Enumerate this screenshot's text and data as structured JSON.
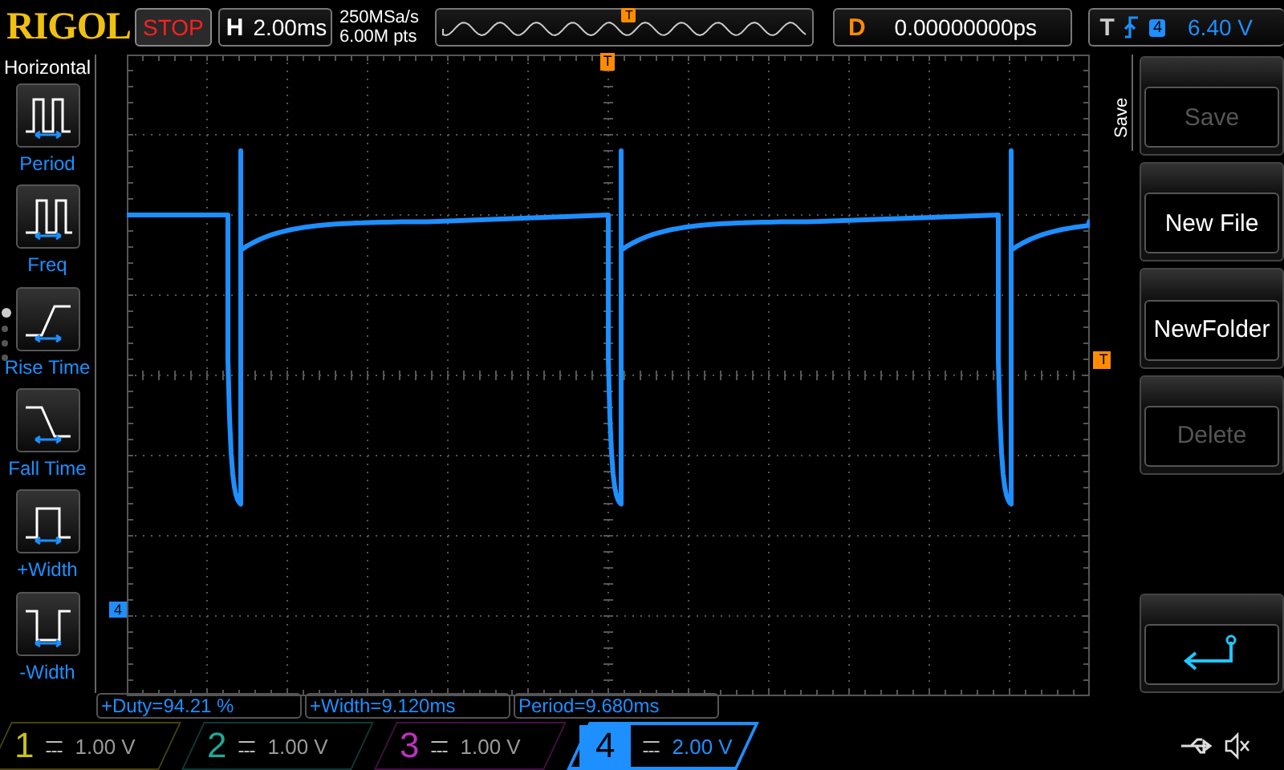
{
  "top_bar": {
    "logo": "RIGOL",
    "run_state": "STOP",
    "horizontal": {
      "label": "H",
      "value": "2.00ms"
    },
    "sample_rate": "250MSa/s",
    "memory_depth": "6.00M pts",
    "trigger_position_marker": "T",
    "delay": {
      "label": "D",
      "value": "0.00000000ps"
    },
    "trigger": {
      "label": "T",
      "source": "4",
      "level": "6.40 V"
    }
  },
  "sidebar": {
    "title": "Horizontal",
    "page_dots": [
      {
        "selected": true
      },
      {
        "selected": false
      },
      {
        "selected": false
      },
      {
        "selected": false
      }
    ],
    "items": [
      {
        "kind": "period",
        "label": "Period"
      },
      {
        "kind": "freq",
        "label": "Freq"
      },
      {
        "kind": "rise",
        "label": "Rise Time"
      },
      {
        "kind": "fall",
        "label": "Fall Time"
      },
      {
        "kind": "pwidth",
        "label": "+Width"
      },
      {
        "kind": "nwidth",
        "label": "-Width"
      }
    ]
  },
  "display": {
    "trigger_position_marker": "T",
    "channel_marker": "4",
    "trigger_level_marker": "T"
  },
  "menu": {
    "title": "Save",
    "buttons": [
      {
        "kind": "text",
        "label": "Save",
        "disabled": true
      },
      {
        "kind": "text",
        "label": "New File",
        "disabled": false
      },
      {
        "kind": "text",
        "label": "NewFolder",
        "disabled": false
      },
      {
        "kind": "text",
        "label": "Delete",
        "disabled": true
      },
      {
        "kind": "spacer"
      },
      {
        "kind": "back"
      }
    ]
  },
  "measurements": [
    "+Duty=94.21 %",
    "+Width=9.120ms",
    "Period=9.680ms"
  ],
  "channels": [
    {
      "number": "1",
      "scale": "1.00 V",
      "selected": false,
      "color": "#c8c020"
    },
    {
      "number": "2",
      "scale": "1.00 V",
      "selected": false,
      "color": "#20a898"
    },
    {
      "number": "3",
      "scale": "1.00 V",
      "selected": false,
      "color": "#c030c0"
    },
    {
      "number": "4",
      "scale": "2.00 V",
      "selected": true,
      "color": "#1e8fff"
    }
  ]
}
